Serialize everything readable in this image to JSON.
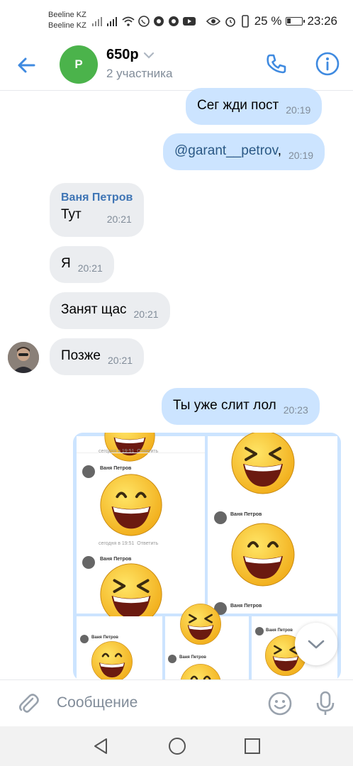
{
  "status_bar": {
    "carrier_1": "Beeline KZ",
    "carrier_2": "Beeline KZ",
    "battery": "25 %",
    "time": "23:26",
    "icons": [
      "signal-icon",
      "wifi-icon",
      "whatsapp-icon",
      "chrome-icon",
      "youtube-icon",
      "eye-icon",
      "alarm-icon",
      "vibrate-icon",
      "battery-icon"
    ]
  },
  "header": {
    "avatar_letter": "P",
    "title": "650р",
    "subtitle": "2 участника",
    "avatar_color": "#4bb34b",
    "accent": "#3f8ae0"
  },
  "messages": [
    {
      "direction": "out",
      "text": "Сег жди пост",
      "time": "20:19"
    },
    {
      "direction": "out",
      "text": "@garant__petrov",
      "suffix": ",",
      "time": "20:19"
    },
    {
      "direction": "in",
      "sender": "Ваня Петров",
      "text": "Тут",
      "time": "20:21"
    },
    {
      "direction": "in",
      "text": "Я",
      "time": "20:21"
    },
    {
      "direction": "in",
      "text": "Занят щас",
      "time": "20:21"
    },
    {
      "direction": "in",
      "text": "Позже",
      "time": "20:21"
    },
    {
      "direction": "out",
      "text": "Ты уже слит лол",
      "time": "20:23"
    }
  ],
  "album": {
    "photos": [
      {
        "poster": "Ваня Петров",
        "meta": "сегодня в 19:51",
        "reply": "Ответить"
      },
      {
        "poster": "Ваня Петров",
        "meta": "сегодня в 19:51",
        "reply": "Ответить"
      },
      {
        "poster": "Ваня Петров",
        "meta": "",
        "reply": ""
      },
      {
        "poster": "Ваня Петров",
        "meta": "",
        "reply": ""
      },
      {
        "poster": "Ваня Петров",
        "meta": "",
        "reply": ""
      }
    ]
  },
  "composer": {
    "placeholder": "Сообщение"
  },
  "colors": {
    "outgoing_bubble": "#cce4ff",
    "incoming_bubble": "#ebedf0",
    "sender_name": "#3f75b5",
    "timestamp": "#818c99"
  }
}
